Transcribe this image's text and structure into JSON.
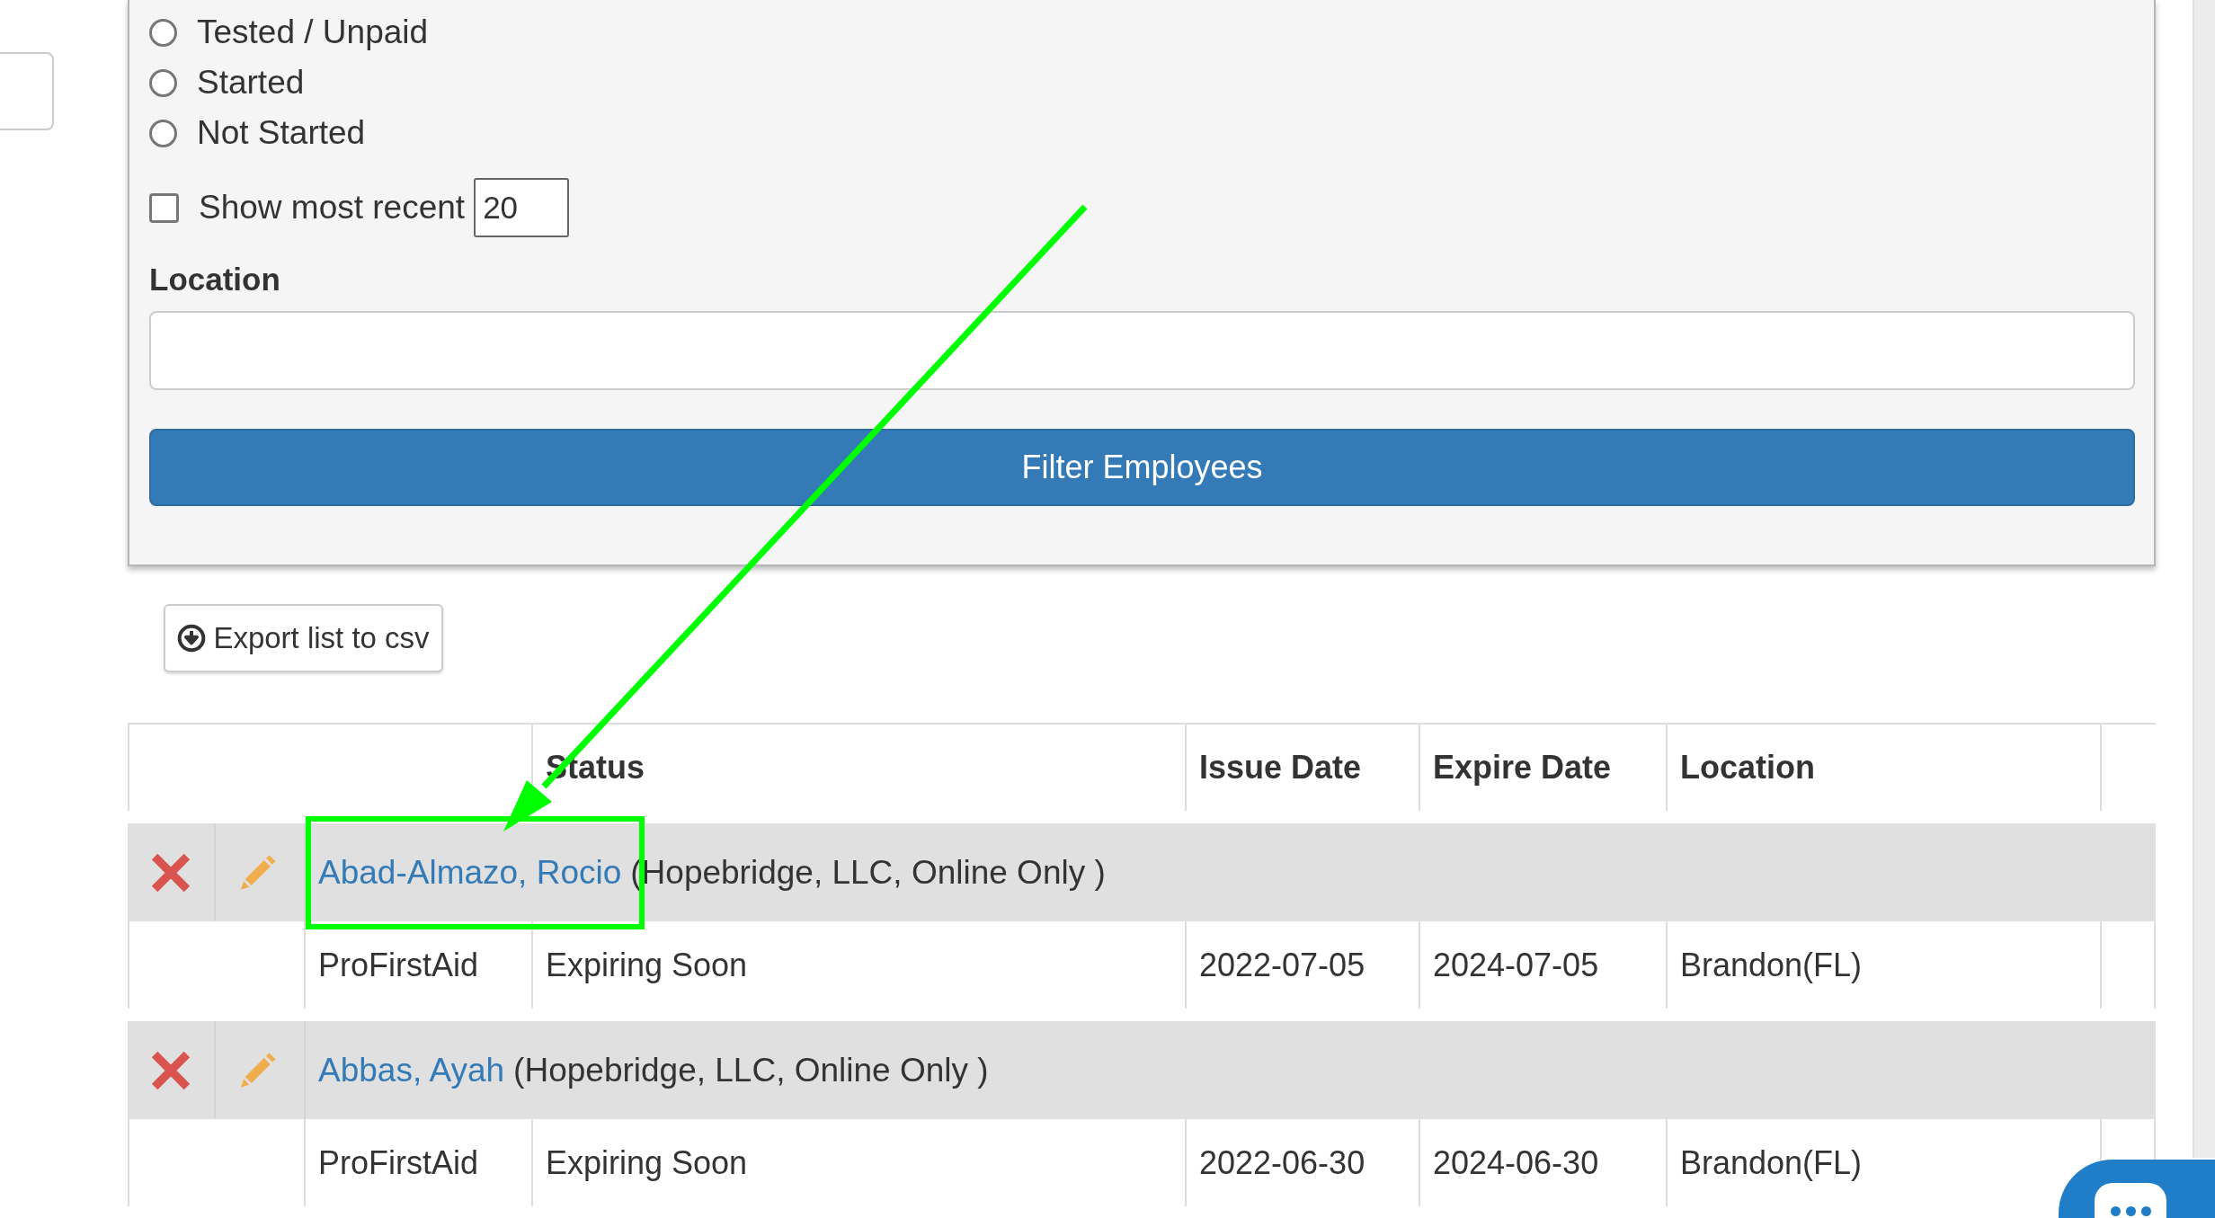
{
  "filter_panel": {
    "status_options": [
      {
        "label": "Tested / Unpaid",
        "selected": false
      },
      {
        "label": "Started",
        "selected": false
      },
      {
        "label": "Not Started",
        "selected": false
      }
    ],
    "show_recent": {
      "label": "Show most recent",
      "checked": false,
      "value": "20"
    },
    "location": {
      "label": "Location"
    },
    "filter_button": "Filter Employees"
  },
  "export_button": "Export list to csv",
  "table": {
    "columns": [
      "Status",
      "Issue Date",
      "Expire Date",
      "Location"
    ],
    "employees": [
      {
        "name": "Abad-Almazo, Rocio",
        "details": "(Hopebridge, LLC, Online Only )",
        "highlighted": true,
        "records": [
          {
            "course": "ProFirstAid",
            "status": "Expiring Soon",
            "issue_date": "2022-07-05",
            "expire_date": "2024-07-05",
            "location": "Brandon(FL)"
          }
        ]
      },
      {
        "name": "Abbas, Ayah",
        "details": "(Hopebridge, LLC, Online Only )",
        "highlighted": false,
        "records": [
          {
            "course": "ProFirstAid",
            "status": "Expiring Soon",
            "issue_date": "2022-06-30",
            "expire_date": "2024-06-30",
            "location": "Brandon(FL)"
          }
        ]
      }
    ]
  }
}
